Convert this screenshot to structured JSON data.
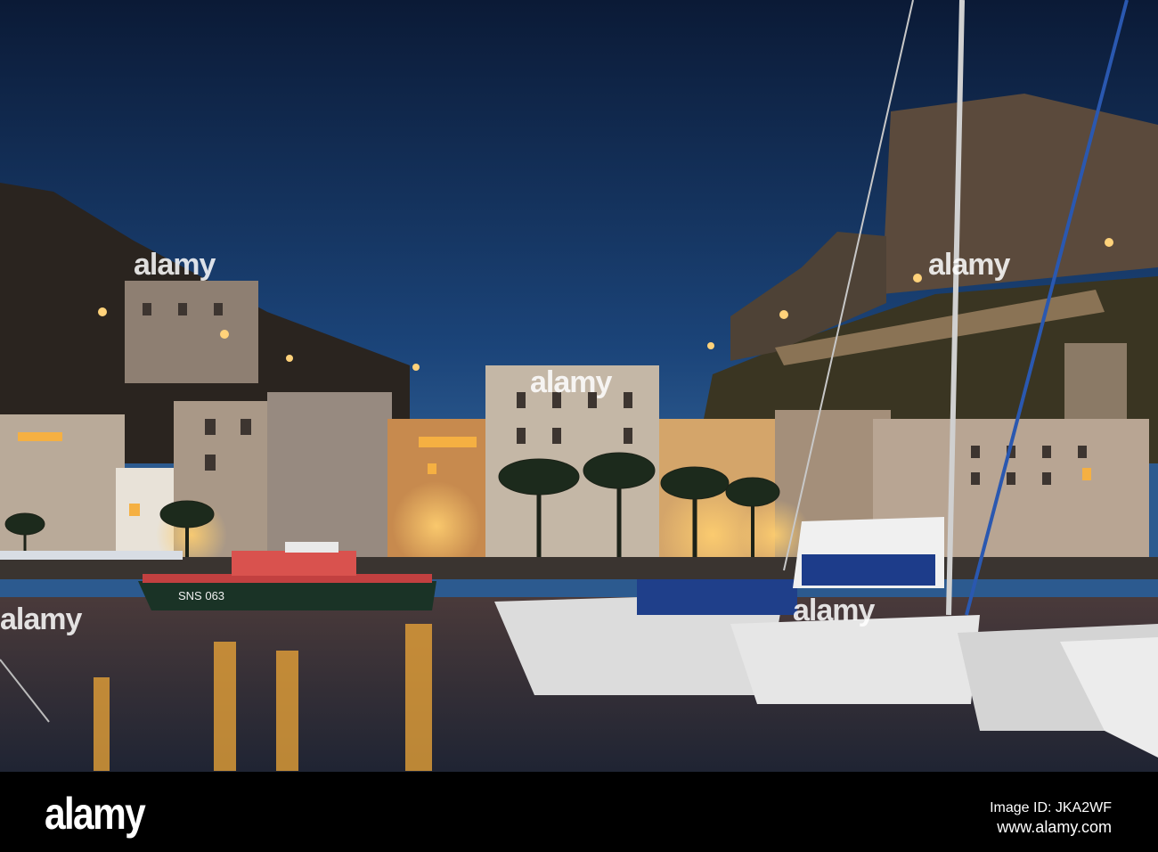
{
  "photo": {
    "subject": "harbour town at dusk with hilltop citadel",
    "boat_label": "SNS 063",
    "colors": {
      "sky_top": "#0d1f3d",
      "sky_mid": "#1d4577",
      "light": "#f5b042",
      "water": "#2a2f3e"
    }
  },
  "watermark": {
    "text": "alamy"
  },
  "footer": {
    "logo": "alamy",
    "image_id": "Image ID: JKA2WF",
    "website": "www.alamy.com"
  }
}
